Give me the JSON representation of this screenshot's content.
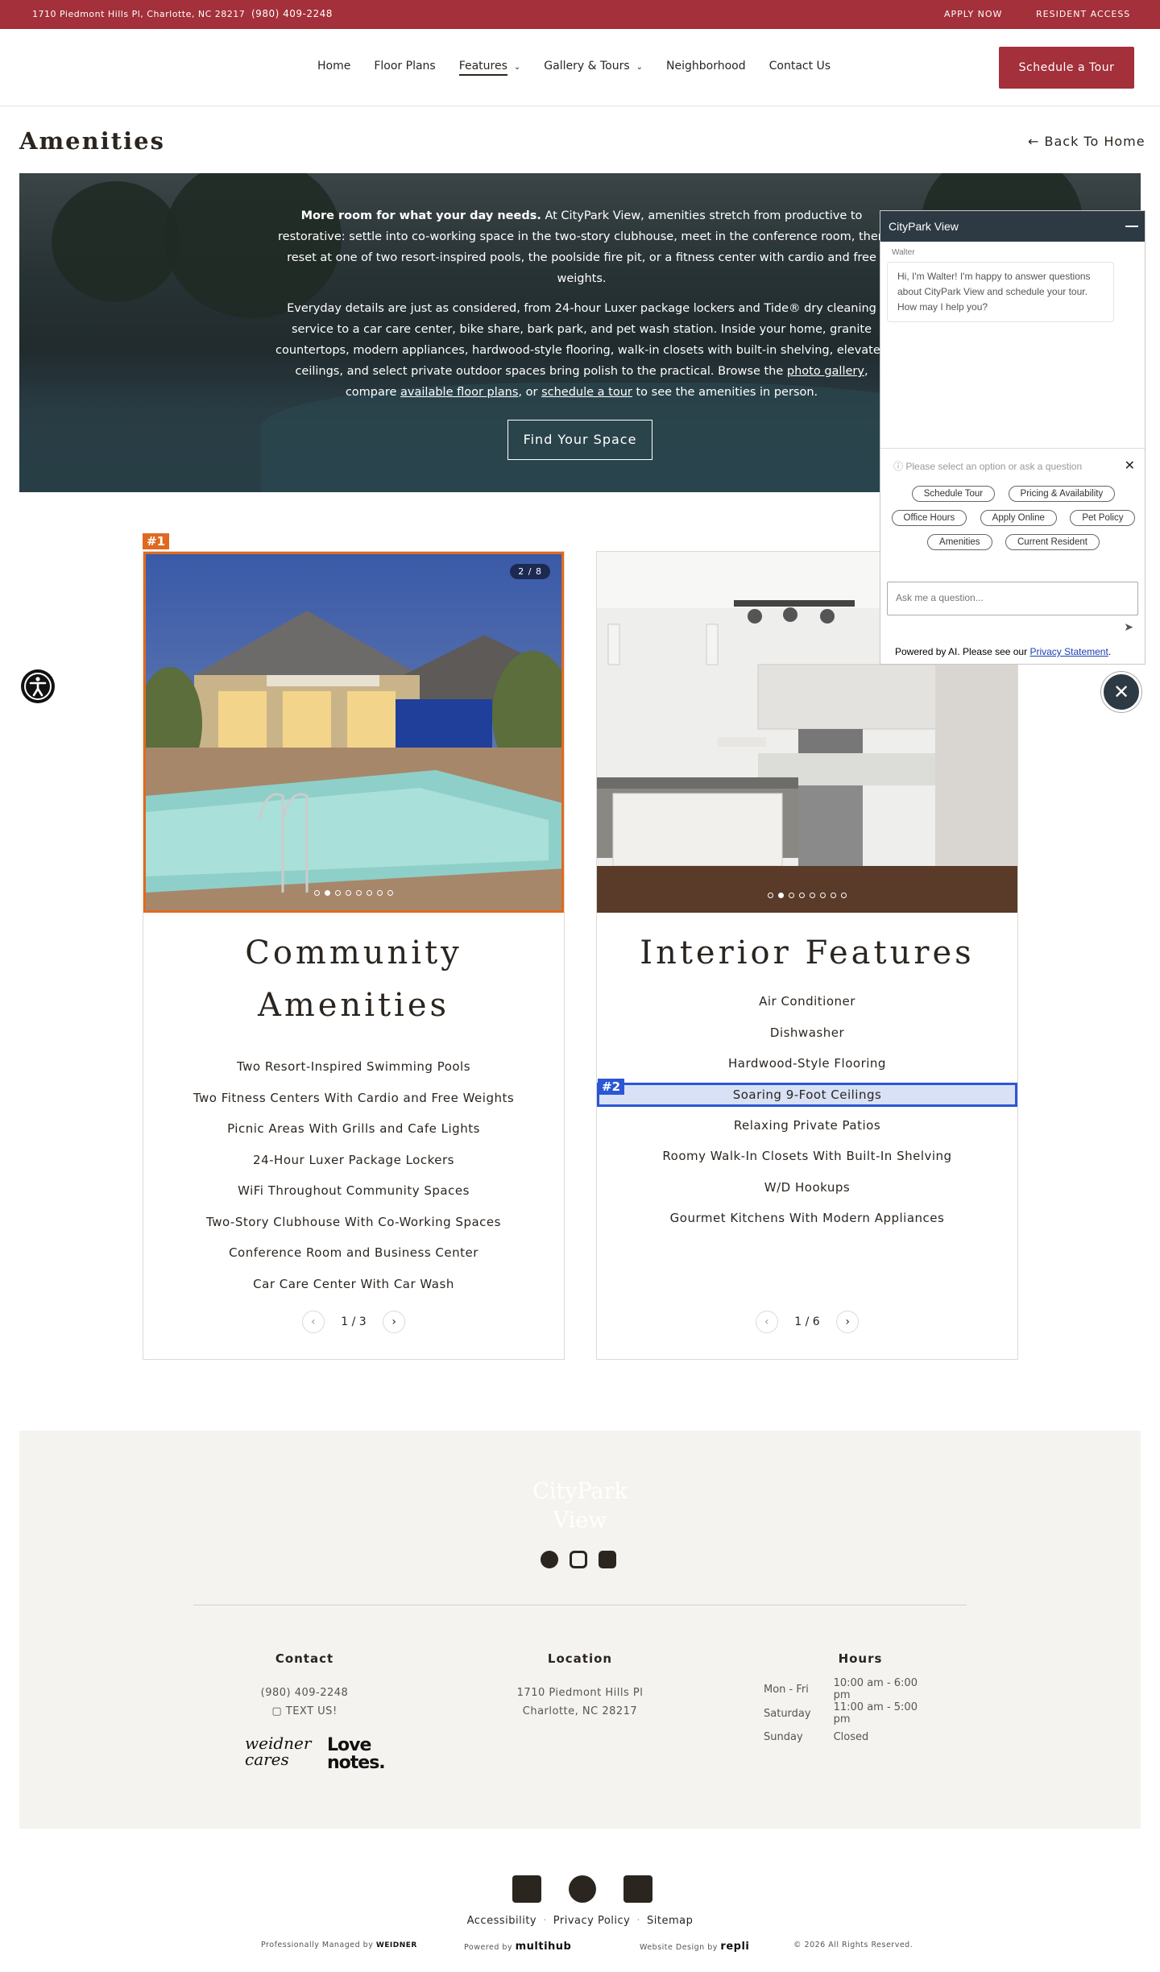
{
  "topbar": {
    "address": "1710 Piedmont Hills Pl, Charlotte, NC 28217",
    "phone": "(980) 409-2248",
    "apply": "APPLY NOW",
    "resident": "RESIDENT ACCESS"
  },
  "nav": {
    "items": [
      "Home",
      "Floor Plans",
      "Features",
      "Gallery & Tours",
      "Neighborhood",
      "Contact Us"
    ],
    "cta": "Schedule a Tour"
  },
  "page": {
    "title": "Amenities",
    "back": "← Back To Home"
  },
  "hero": {
    "lead_bold": "More room for what your day needs.",
    "lead_rest": " At CityPark View, amenities stretch from productive to restorative: settle into co-working space in the two-story clubhouse, meet in the conference room, then reset at one of two resort-inspired pools, the poolside fire pit, or a fitness center with cardio and free weights.",
    "para2_a": "Everyday details are just as considered, from 24-hour Luxer package lockers and Tide® dry cleaning service to a car care center, bike share, bark park, and pet wash station. Inside your home, granite countertops, modern appliances, hardwood-style flooring, walk-in closets with built-in shelving, elevated ceilings, and select private outdoor spaces bring polish to the practical. Browse the ",
    "link_gallery": "photo gallery",
    "para2_b": ", compare ",
    "link_floorplans": "available floor plans",
    "para2_c": ", or ",
    "link_tour": "schedule a tour",
    "para2_d": " to see the amenities in person.",
    "button": "Find Your Space"
  },
  "cards": [
    {
      "badge": "#1",
      "counter": "2 / 8",
      "title_line1": "Community",
      "title_line2": "Amenities",
      "features": [
        "Two Resort-Inspired Swimming Pools",
        "Two Fitness Centers With Cardio and Free Weights",
        "Picnic Areas With Grills and Cafe Lights",
        "24-Hour Luxer Package Lockers",
        "WiFi Throughout Community Spaces",
        "Two-Story Clubhouse With Co-Working Spaces",
        "Conference Room and Business Center",
        "Car Care Center With Car Wash"
      ],
      "page": "1 / 3"
    },
    {
      "badge": "#2",
      "title": "Interior Features",
      "features": [
        "Air Conditioner",
        "Dishwasher",
        "Hardwood-Style Flooring",
        "Soaring 9-Foot Ceilings",
        "Relaxing Private Patios",
        "Roomy Walk-In Closets With Built-In Shelving",
        "W/D Hookups",
        "Gourmet Kitchens With Modern Appliances"
      ],
      "page": "1 / 6"
    }
  ],
  "chat": {
    "title": "CityPark View",
    "sender": "Walter",
    "message": "Hi, I'm Walter! I'm happy to answer questions about CityPark View and schedule your tour. How may I help you?",
    "prompt": "Please select an option or ask a question",
    "options": [
      "Schedule Tour",
      "Pricing & Availability",
      "Office Hours",
      "Apply Online",
      "Pet Policy",
      "Amenities",
      "Current Resident"
    ],
    "input_placeholder": "Ask me a question...",
    "powered": "Powered by AI. Please see our ",
    "privacy_link": "Privacy Statement",
    "powered_end": "."
  },
  "footer": {
    "logo_line1": "CityPark",
    "logo_line2": "View",
    "contact_heading": "Contact",
    "contact_phone": "(980) 409-2248",
    "contact_text": "TEXT US!",
    "location_heading": "Location",
    "location_line1": "1710 Piedmont Hills Pl",
    "location_line2": "Charlotte, NC 28217",
    "hours_heading": "Hours",
    "hours": [
      {
        "day": "Mon - Fri",
        "time": "10:00 am - 6:00 pm"
      },
      {
        "day": "Saturday",
        "time": "11:00 am - 5:00 pm"
      },
      {
        "day": "Sunday",
        "time": "Closed"
      }
    ],
    "weidner_line1": "weidner",
    "weidner_line2": "cares",
    "lovenotes_line1": "Love",
    "lovenotes_line2": "notes."
  },
  "bottom": {
    "links": [
      "Accessibility",
      "Privacy Policy",
      "Sitemap"
    ],
    "managed": "Professionally Managed by",
    "managed_brand": "WEIDNER",
    "powered": "Powered by",
    "powered_brand": "multihub",
    "design": "Website Design by",
    "design_brand": "repli",
    "copyright": "© 2026 All Rights Reserved."
  },
  "colors": {
    "brand_red": "#a3303a",
    "highlight_orange": "#e06a20",
    "highlight_blue": "#2a57d6",
    "chat_dark": "#2d3a44"
  }
}
